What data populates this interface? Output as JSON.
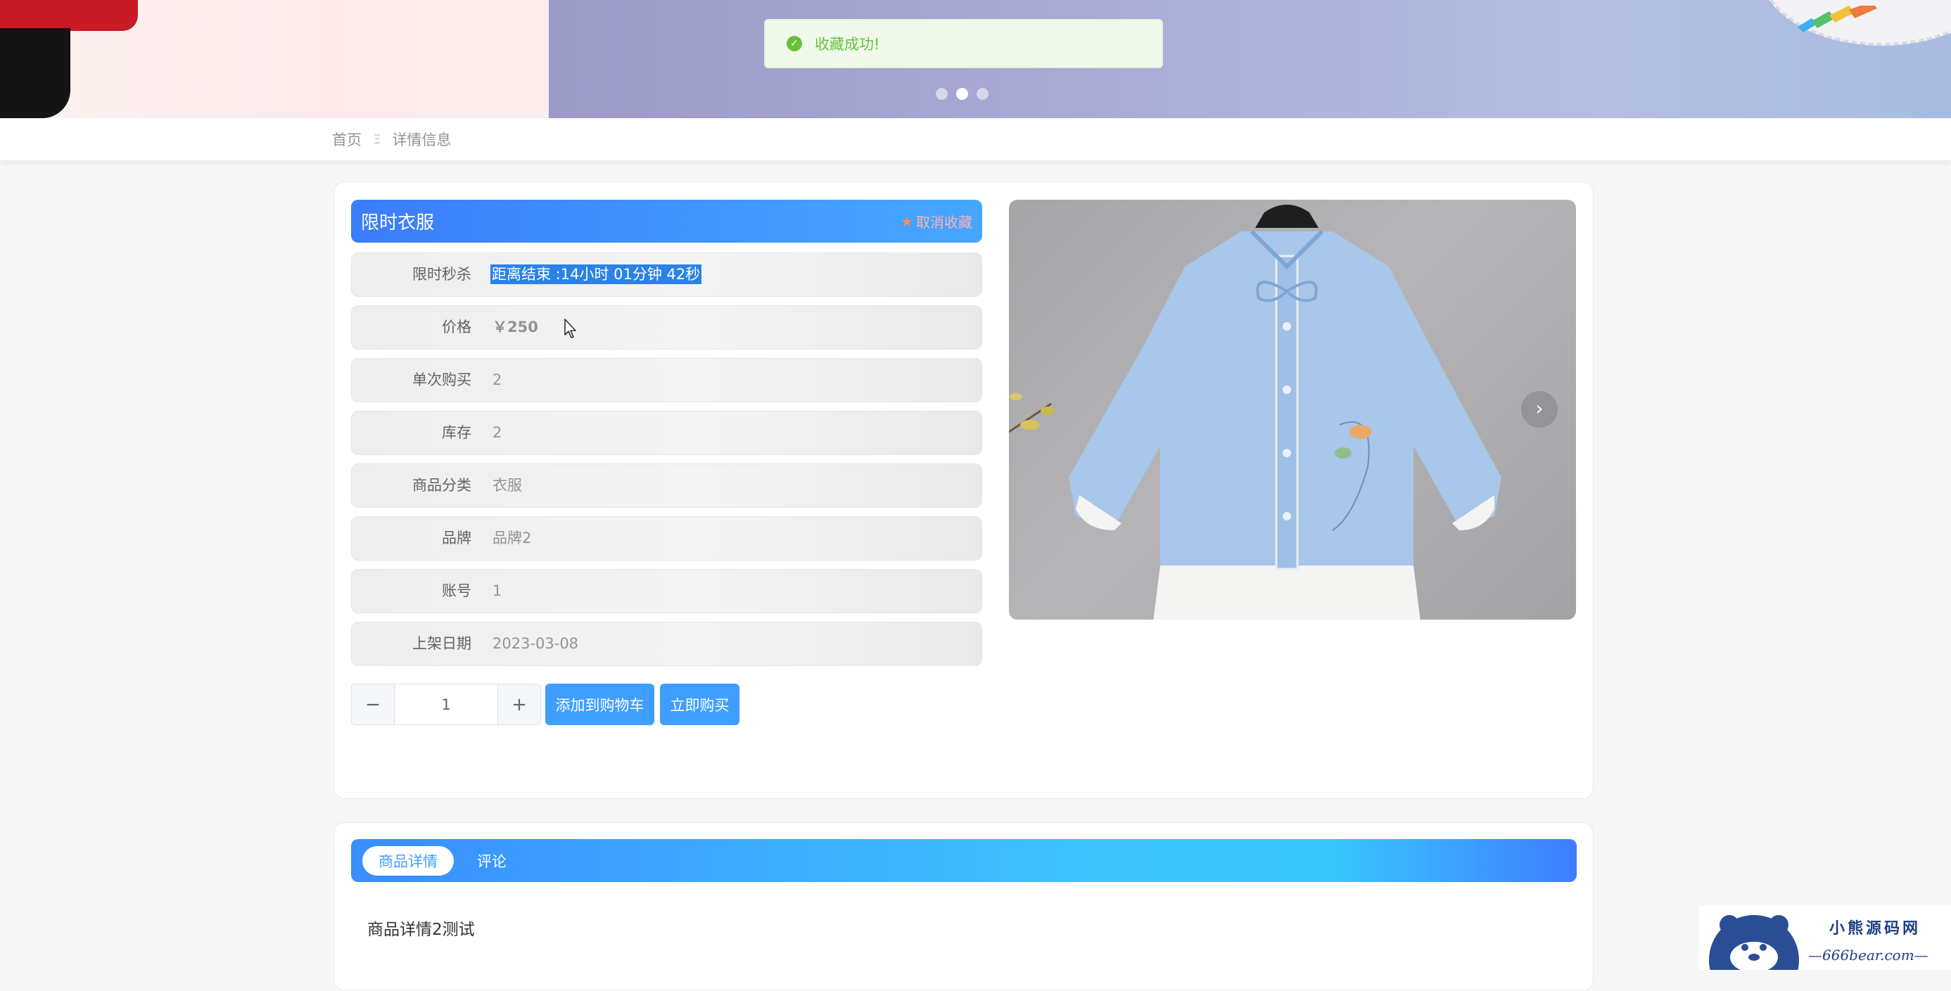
{
  "toast": {
    "icon": "check-circle-icon",
    "message": "收藏成功!"
  },
  "carousel": {
    "total": 3,
    "active_index": 1
  },
  "breadcrumb": {
    "home": "首页",
    "separator": "Ξ",
    "current": "详情信息"
  },
  "product": {
    "name": "限时衣服",
    "favorite_label": "取消收藏",
    "favorite_icon": "star-icon",
    "fields": [
      {
        "label": "限时秒杀",
        "value": "距离结束 :14小时 01分钟 42秒"
      },
      {
        "label": "价格",
        "value": "￥250"
      },
      {
        "label": "单次购买",
        "value": "2"
      },
      {
        "label": "库存",
        "value": "2"
      },
      {
        "label": "商品分类",
        "value": "衣服"
      },
      {
        "label": "品牌",
        "value": "品牌2"
      },
      {
        "label": "账号",
        "value": "1"
      },
      {
        "label": "上架日期",
        "value": "2023-03-08"
      }
    ],
    "quantity": "1",
    "add_to_cart": "添加到购物车",
    "buy_now": "立即购买"
  },
  "gallery": {
    "prev_icon": "chevron-left-icon",
    "next_icon": "chevron-right-icon",
    "prev_glyph": "‹",
    "next_glyph": "›"
  },
  "tabs": {
    "detail": "商品详情",
    "comments": "评论"
  },
  "detail_text": "商品详情2测试",
  "watermark": {
    "title": "小熊源码网",
    "url": "—666bear.com—"
  },
  "colors": {
    "primary": "#409eff",
    "success": "#67c23a",
    "title_bar": "#3b7dfa",
    "selection": "#2b82e7"
  }
}
